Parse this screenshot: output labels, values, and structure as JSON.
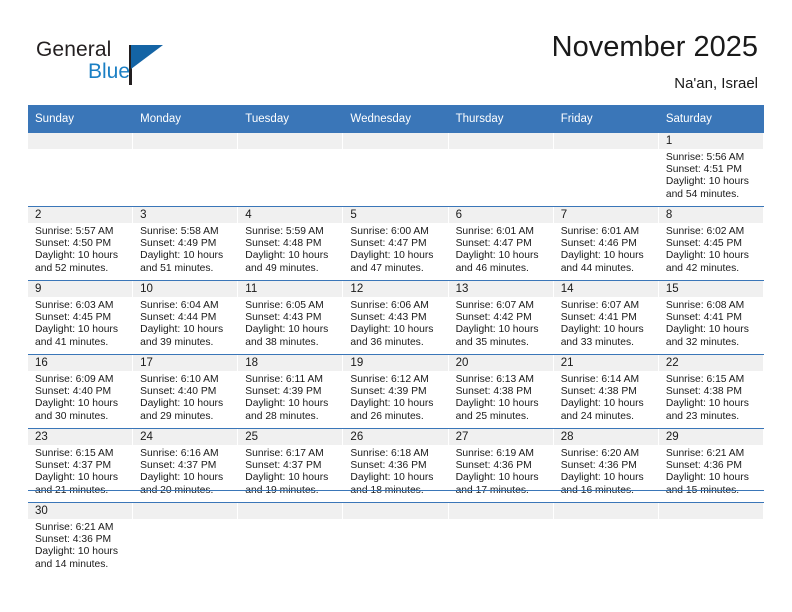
{
  "brand": {
    "name_part1": "General",
    "name_part2": "Blue",
    "triangle_color": "#1464a5",
    "blue_color": "#1b7fc4"
  },
  "header": {
    "title": "November 2025",
    "location": "Na'an, Israel"
  },
  "theme": {
    "header_blue": "#3a76b8",
    "day_band_gray": "#f0f0f0",
    "text_color": "#1a1a1a"
  },
  "weekday_headers": [
    "Sunday",
    "Monday",
    "Tuesday",
    "Wednesday",
    "Thursday",
    "Friday",
    "Saturday"
  ],
  "weeks": [
    [
      {
        "day": "",
        "empty": true,
        "sunrise": "",
        "sunset": "",
        "daylight_line1": "",
        "daylight_line2": ""
      },
      {
        "day": "",
        "empty": true,
        "sunrise": "",
        "sunset": "",
        "daylight_line1": "",
        "daylight_line2": ""
      },
      {
        "day": "",
        "empty": true,
        "sunrise": "",
        "sunset": "",
        "daylight_line1": "",
        "daylight_line2": ""
      },
      {
        "day": "",
        "empty": true,
        "sunrise": "",
        "sunset": "",
        "daylight_line1": "",
        "daylight_line2": ""
      },
      {
        "day": "",
        "empty": true,
        "sunrise": "",
        "sunset": "",
        "daylight_line1": "",
        "daylight_line2": ""
      },
      {
        "day": "",
        "empty": true,
        "sunrise": "",
        "sunset": "",
        "daylight_line1": "",
        "daylight_line2": ""
      },
      {
        "day": "1",
        "empty": false,
        "sunrise": "Sunrise: 5:56 AM",
        "sunset": "Sunset: 4:51 PM",
        "daylight_line1": "Daylight: 10 hours",
        "daylight_line2": "and 54 minutes."
      }
    ],
    [
      {
        "day": "2",
        "empty": false,
        "sunrise": "Sunrise: 5:57 AM",
        "sunset": "Sunset: 4:50 PM",
        "daylight_line1": "Daylight: 10 hours",
        "daylight_line2": "and 52 minutes."
      },
      {
        "day": "3",
        "empty": false,
        "sunrise": "Sunrise: 5:58 AM",
        "sunset": "Sunset: 4:49 PM",
        "daylight_line1": "Daylight: 10 hours",
        "daylight_line2": "and 51 minutes."
      },
      {
        "day": "4",
        "empty": false,
        "sunrise": "Sunrise: 5:59 AM",
        "sunset": "Sunset: 4:48 PM",
        "daylight_line1": "Daylight: 10 hours",
        "daylight_line2": "and 49 minutes."
      },
      {
        "day": "5",
        "empty": false,
        "sunrise": "Sunrise: 6:00 AM",
        "sunset": "Sunset: 4:47 PM",
        "daylight_line1": "Daylight: 10 hours",
        "daylight_line2": "and 47 minutes."
      },
      {
        "day": "6",
        "empty": false,
        "sunrise": "Sunrise: 6:01 AM",
        "sunset": "Sunset: 4:47 PM",
        "daylight_line1": "Daylight: 10 hours",
        "daylight_line2": "and 46 minutes."
      },
      {
        "day": "7",
        "empty": false,
        "sunrise": "Sunrise: 6:01 AM",
        "sunset": "Sunset: 4:46 PM",
        "daylight_line1": "Daylight: 10 hours",
        "daylight_line2": "and 44 minutes."
      },
      {
        "day": "8",
        "empty": false,
        "sunrise": "Sunrise: 6:02 AM",
        "sunset": "Sunset: 4:45 PM",
        "daylight_line1": "Daylight: 10 hours",
        "daylight_line2": "and 42 minutes."
      }
    ],
    [
      {
        "day": "9",
        "empty": false,
        "sunrise": "Sunrise: 6:03 AM",
        "sunset": "Sunset: 4:45 PM",
        "daylight_line1": "Daylight: 10 hours",
        "daylight_line2": "and 41 minutes."
      },
      {
        "day": "10",
        "empty": false,
        "sunrise": "Sunrise: 6:04 AM",
        "sunset": "Sunset: 4:44 PM",
        "daylight_line1": "Daylight: 10 hours",
        "daylight_line2": "and 39 minutes."
      },
      {
        "day": "11",
        "empty": false,
        "sunrise": "Sunrise: 6:05 AM",
        "sunset": "Sunset: 4:43 PM",
        "daylight_line1": "Daylight: 10 hours",
        "daylight_line2": "and 38 minutes."
      },
      {
        "day": "12",
        "empty": false,
        "sunrise": "Sunrise: 6:06 AM",
        "sunset": "Sunset: 4:43 PM",
        "daylight_line1": "Daylight: 10 hours",
        "daylight_line2": "and 36 minutes."
      },
      {
        "day": "13",
        "empty": false,
        "sunrise": "Sunrise: 6:07 AM",
        "sunset": "Sunset: 4:42 PM",
        "daylight_line1": "Daylight: 10 hours",
        "daylight_line2": "and 35 minutes."
      },
      {
        "day": "14",
        "empty": false,
        "sunrise": "Sunrise: 6:07 AM",
        "sunset": "Sunset: 4:41 PM",
        "daylight_line1": "Daylight: 10 hours",
        "daylight_line2": "and 33 minutes."
      },
      {
        "day": "15",
        "empty": false,
        "sunrise": "Sunrise: 6:08 AM",
        "sunset": "Sunset: 4:41 PM",
        "daylight_line1": "Daylight: 10 hours",
        "daylight_line2": "and 32 minutes."
      }
    ],
    [
      {
        "day": "16",
        "empty": false,
        "sunrise": "Sunrise: 6:09 AM",
        "sunset": "Sunset: 4:40 PM",
        "daylight_line1": "Daylight: 10 hours",
        "daylight_line2": "and 30 minutes."
      },
      {
        "day": "17",
        "empty": false,
        "sunrise": "Sunrise: 6:10 AM",
        "sunset": "Sunset: 4:40 PM",
        "daylight_line1": "Daylight: 10 hours",
        "daylight_line2": "and 29 minutes."
      },
      {
        "day": "18",
        "empty": false,
        "sunrise": "Sunrise: 6:11 AM",
        "sunset": "Sunset: 4:39 PM",
        "daylight_line1": "Daylight: 10 hours",
        "daylight_line2": "and 28 minutes."
      },
      {
        "day": "19",
        "empty": false,
        "sunrise": "Sunrise: 6:12 AM",
        "sunset": "Sunset: 4:39 PM",
        "daylight_line1": "Daylight: 10 hours",
        "daylight_line2": "and 26 minutes."
      },
      {
        "day": "20",
        "empty": false,
        "sunrise": "Sunrise: 6:13 AM",
        "sunset": "Sunset: 4:38 PM",
        "daylight_line1": "Daylight: 10 hours",
        "daylight_line2": "and 25 minutes."
      },
      {
        "day": "21",
        "empty": false,
        "sunrise": "Sunrise: 6:14 AM",
        "sunset": "Sunset: 4:38 PM",
        "daylight_line1": "Daylight: 10 hours",
        "daylight_line2": "and 24 minutes."
      },
      {
        "day": "22",
        "empty": false,
        "sunrise": "Sunrise: 6:15 AM",
        "sunset": "Sunset: 4:38 PM",
        "daylight_line1": "Daylight: 10 hours",
        "daylight_line2": "and 23 minutes."
      }
    ],
    [
      {
        "day": "23",
        "empty": false,
        "sunrise": "Sunrise: 6:15 AM",
        "sunset": "Sunset: 4:37 PM",
        "daylight_line1": "Daylight: 10 hours",
        "daylight_line2": "and 21 minutes."
      },
      {
        "day": "24",
        "empty": false,
        "sunrise": "Sunrise: 6:16 AM",
        "sunset": "Sunset: 4:37 PM",
        "daylight_line1": "Daylight: 10 hours",
        "daylight_line2": "and 20 minutes."
      },
      {
        "day": "25",
        "empty": false,
        "sunrise": "Sunrise: 6:17 AM",
        "sunset": "Sunset: 4:37 PM",
        "daylight_line1": "Daylight: 10 hours",
        "daylight_line2": "and 19 minutes."
      },
      {
        "day": "26",
        "empty": false,
        "sunrise": "Sunrise: 6:18 AM",
        "sunset": "Sunset: 4:36 PM",
        "daylight_line1": "Daylight: 10 hours",
        "daylight_line2": "and 18 minutes."
      },
      {
        "day": "27",
        "empty": false,
        "sunrise": "Sunrise: 6:19 AM",
        "sunset": "Sunset: 4:36 PM",
        "daylight_line1": "Daylight: 10 hours",
        "daylight_line2": "and 17 minutes."
      },
      {
        "day": "28",
        "empty": false,
        "sunrise": "Sunrise: 6:20 AM",
        "sunset": "Sunset: 4:36 PM",
        "daylight_line1": "Daylight: 10 hours",
        "daylight_line2": "and 16 minutes."
      },
      {
        "day": "29",
        "empty": false,
        "sunrise": "Sunrise: 6:21 AM",
        "sunset": "Sunset: 4:36 PM",
        "daylight_line1": "Daylight: 10 hours",
        "daylight_line2": "and 15 minutes."
      }
    ],
    [
      {
        "day": "30",
        "empty": false,
        "sunrise": "Sunrise: 6:21 AM",
        "sunset": "Sunset: 4:36 PM",
        "daylight_line1": "Daylight: 10 hours",
        "daylight_line2": "and 14 minutes."
      },
      {
        "day": "",
        "empty": true,
        "sunrise": "",
        "sunset": "",
        "daylight_line1": "",
        "daylight_line2": ""
      },
      {
        "day": "",
        "empty": true,
        "sunrise": "",
        "sunset": "",
        "daylight_line1": "",
        "daylight_line2": ""
      },
      {
        "day": "",
        "empty": true,
        "sunrise": "",
        "sunset": "",
        "daylight_line1": "",
        "daylight_line2": ""
      },
      {
        "day": "",
        "empty": true,
        "sunrise": "",
        "sunset": "",
        "daylight_line1": "",
        "daylight_line2": ""
      },
      {
        "day": "",
        "empty": true,
        "sunrise": "",
        "sunset": "",
        "daylight_line1": "",
        "daylight_line2": ""
      },
      {
        "day": "",
        "empty": true,
        "sunrise": "",
        "sunset": "",
        "daylight_line1": "",
        "daylight_line2": ""
      }
    ]
  ]
}
